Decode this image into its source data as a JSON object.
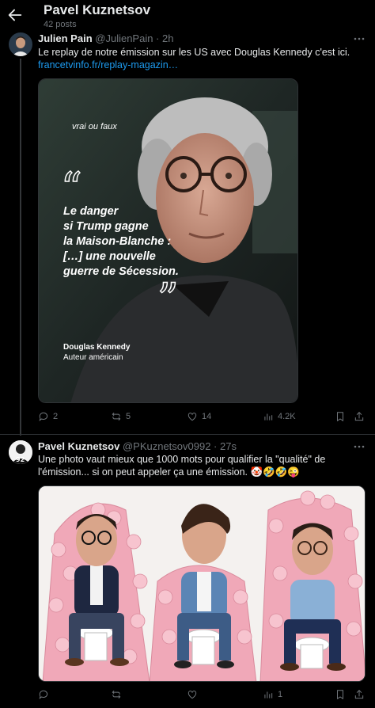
{
  "header": {
    "title": "Pavel Kuznetsov",
    "subtitle": "42 posts"
  },
  "tweets": [
    {
      "name": "Julien Pain",
      "handle": "@JulienPain · 2h",
      "text": "Le replay de notre émission sur les US avec Douglas Kennedy c'est ici.",
      "link": "francetvinfo.fr/replay-magazin…",
      "media": {
        "logo": "vrai ou faux",
        "quote_lines": [
          "Le danger",
          "si Trump gagne",
          "la Maison-Blanche :",
          "[…] une nouvelle",
          "guerre de Sécession."
        ],
        "person_name": "Douglas Kennedy",
        "person_role": "Auteur américain"
      },
      "actions": {
        "replies": "2",
        "reposts": "5",
        "likes": "14",
        "views": "4.2K"
      }
    },
    {
      "name": "Pavel Kuznetsov",
      "handle": "@PKuznetsov0992 · 27s",
      "text_line1": "Une photo vaut mieux que 1000 mots pour qualifier la \"qualité\" de",
      "text_line2": "l'émission... si on peut appeler ça une émission. 🤡🤣🤣😜",
      "actions": {
        "replies": "",
        "reposts": "",
        "likes": "",
        "views": "1"
      }
    }
  ],
  "colors": {
    "background": "#000000",
    "text": "#e7e9ea",
    "muted": "#71767b",
    "link": "#1d9bf0",
    "border": "#2f3336"
  }
}
